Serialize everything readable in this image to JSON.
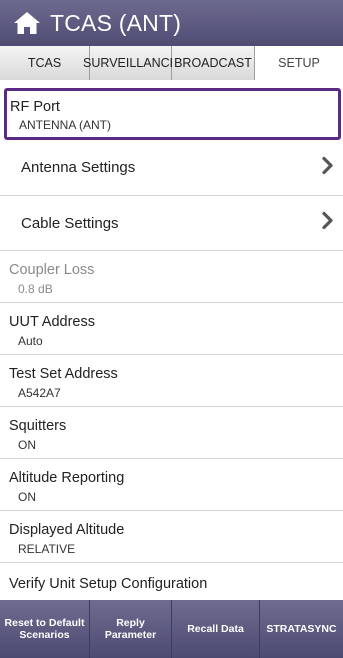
{
  "header": {
    "title": "TCAS (ANT)",
    "home_icon": "home-icon"
  },
  "tabs": [
    {
      "label": "TCAS"
    },
    {
      "label": "SURVEILLANCE"
    },
    {
      "label": "BROADCAST"
    },
    {
      "label": "SETUP",
      "active": true
    }
  ],
  "settings": {
    "rf_port": {
      "label": "RF Port",
      "value": "ANTENNA (ANT)"
    },
    "antenna_settings": {
      "label": "Antenna Settings"
    },
    "cable_settings": {
      "label": "Cable Settings"
    },
    "coupler_loss": {
      "label": "Coupler Loss",
      "value": "0.8 dB"
    },
    "uut_address": {
      "label": "UUT Address",
      "value": "Auto"
    },
    "test_set_address": {
      "label": "Test Set Address",
      "value": "A542A7"
    },
    "squitters": {
      "label": "Squitters",
      "value": "ON"
    },
    "altitude_reporting": {
      "label": "Altitude Reporting",
      "value": "ON"
    },
    "displayed_altitude": {
      "label": "Displayed Altitude",
      "value": "RELATIVE"
    },
    "verify_unit": {
      "label": "Verify Unit Setup Configuration"
    }
  },
  "footer": {
    "reset_line1": "Reset to Default",
    "reset_line2": "Scenarios",
    "reply_line1": "Reply",
    "reply_line2": "Parameter",
    "recall": "Recall Data",
    "stratasync": "STRATASYNC"
  },
  "colors": {
    "header": "#5c5982",
    "selected_border": "#5a2a84",
    "disabled_text": "#8a8a8a"
  }
}
